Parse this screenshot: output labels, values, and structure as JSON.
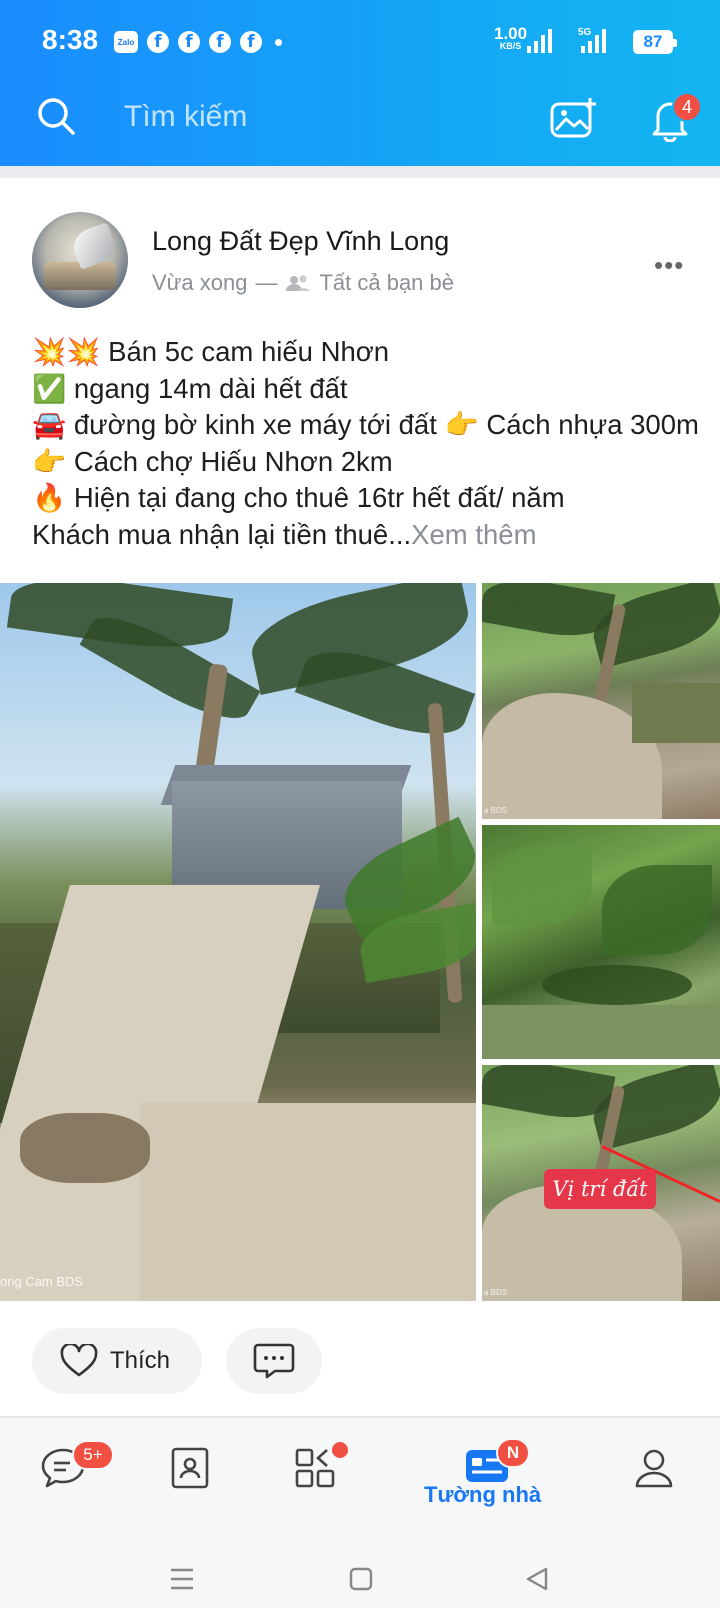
{
  "status_bar": {
    "time": "8:38",
    "notifications": [
      "Zalo",
      "facebook",
      "facebook",
      "facebook",
      "facebook"
    ],
    "net_speed": "1.00",
    "net_unit": "KB/S",
    "network": "5G",
    "battery": "87"
  },
  "header": {
    "search_placeholder": "Tìm kiếm",
    "notification_count": "4",
    "icons": [
      "search-icon",
      "add-photo-icon",
      "bell-icon"
    ]
  },
  "post": {
    "author": "Long Đất Đẹp Vĩnh Long",
    "time": "Vừa xong",
    "separator": "—",
    "audience": "Tất cả bạn bè",
    "lines": [
      "💥💥 Bán 5c cam hiếu Nhơn",
      "✅ ngang 14m dài hết đất",
      "🚘 đường bờ kinh xe máy tới đất 👉 Cách nhựa 300m 👉 Cách chợ Hiếu Nhơn 2km",
      "🔥 Hiện tại đang cho thuê 16tr hết đất/ năm"
    ],
    "last_line": "Khách mua nhận lại tiền thuê...",
    "see_more": "Xem thêm",
    "photo_watermark": "ong Cam BDS",
    "photo_small_watermark": "a BDS",
    "location_label": "Vị trí đất",
    "like_label": "Thích"
  },
  "bottom_nav": {
    "messages_badge": "5+",
    "discover_badge": "",
    "timeline_badge": "N",
    "timeline_label": "Tường nhà",
    "active_color": "#1877f2"
  },
  "colors": {
    "header_start": "#1a8cff",
    "header_end": "#13b6f0",
    "badge": "#f04f42"
  }
}
